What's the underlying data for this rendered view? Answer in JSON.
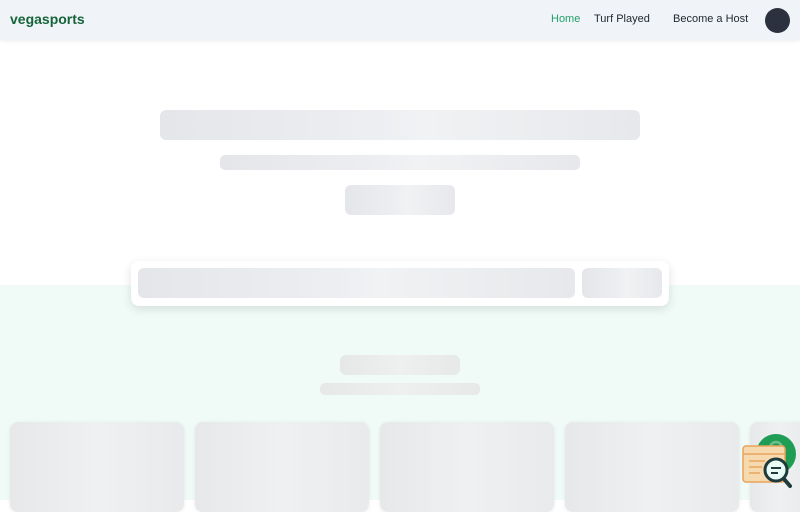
{
  "navbar": {
    "brand": "vegasports",
    "links": [
      {
        "label": "Home",
        "active": true
      },
      {
        "label": "Turf Played",
        "active": false
      },
      {
        "label": "Become a Host",
        "active": false
      }
    ]
  },
  "colors": {
    "brand": "#15643c",
    "accent": "#22a06b",
    "navbar_bg": "#f0f3f7",
    "lower_section_bg": "#f0fbf7",
    "avatar": "#2c3140"
  },
  "icons": {
    "avatar": "user-avatar-icon",
    "floating_widget": "chat-search-icon"
  }
}
